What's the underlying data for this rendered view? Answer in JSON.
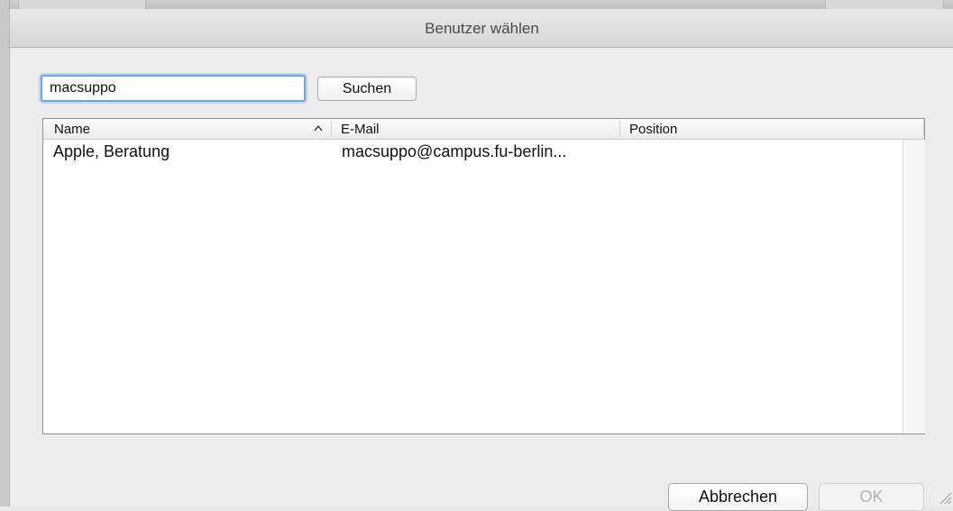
{
  "dialog": {
    "title": "Benutzer wählen"
  },
  "search": {
    "value": "macsuppo",
    "button_label": "Suchen"
  },
  "table": {
    "columns": [
      "Name",
      "E-Mail",
      "Position"
    ],
    "sorted_column": "Name",
    "sort_direction": "ascending",
    "rows": [
      {
        "name": "Apple, Beratung",
        "email": "macsuppo@campus.fu-berlin...",
        "position": ""
      }
    ]
  },
  "footer": {
    "cancel_label": "Abbrechen",
    "ok_label": "OK",
    "ok_enabled": false
  },
  "colors": {
    "focus_ring": "#6ba3e8",
    "disabled_text": "#b4b4b4"
  }
}
